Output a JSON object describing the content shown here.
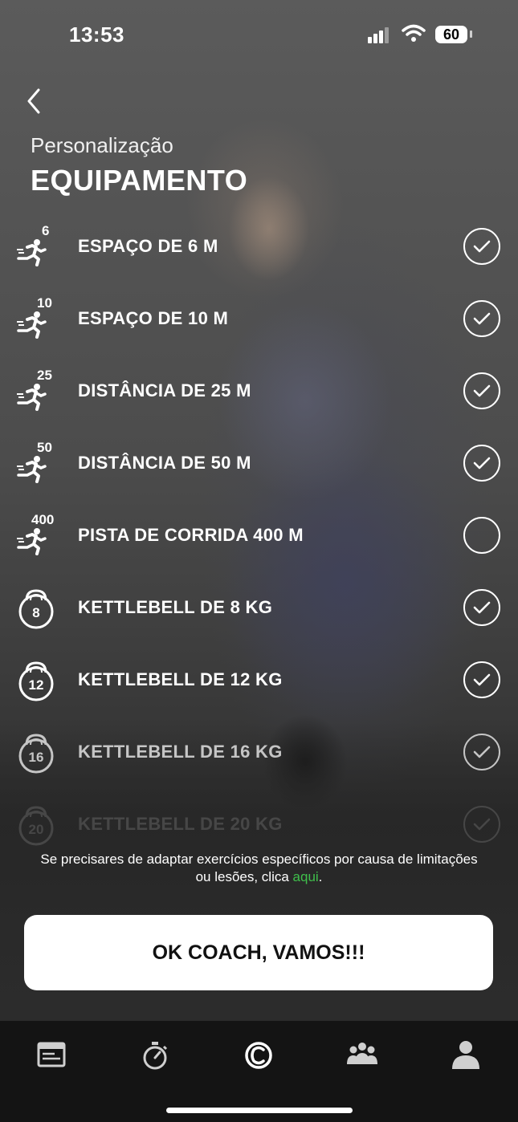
{
  "status_bar": {
    "time": "13:53",
    "battery": "60"
  },
  "header": {
    "subtitle": "Personalização",
    "title": "EQUIPAMENTO"
  },
  "equipment": [
    {
      "icon": "runner-icon",
      "badge": "6",
      "label": "ESPAÇO DE 6 M",
      "checked": true
    },
    {
      "icon": "runner-icon",
      "badge": "10",
      "label": "ESPAÇO DE 10 M",
      "checked": true
    },
    {
      "icon": "runner-icon",
      "badge": "25",
      "label": "DISTÂNCIA DE 25 M",
      "checked": true
    },
    {
      "icon": "runner-icon",
      "badge": "50",
      "label": "DISTÂNCIA DE 50 M",
      "checked": true
    },
    {
      "icon": "runner-icon",
      "badge": "400",
      "label": "PISTA DE CORRIDA 400 M",
      "checked": false
    },
    {
      "icon": "kettlebell-icon",
      "badge": "8",
      "label": "KETTLEBELL DE 8 KG",
      "checked": true
    },
    {
      "icon": "kettlebell-icon",
      "badge": "12",
      "label": "KETTLEBELL DE 12 KG",
      "checked": true
    },
    {
      "icon": "kettlebell-icon",
      "badge": "16",
      "label": "KETTLEBELL DE 16 KG",
      "checked": true
    },
    {
      "icon": "kettlebell-icon",
      "badge": "20",
      "label": "KETTLEBELL DE 20 KG",
      "checked": true
    }
  ],
  "notice": {
    "text": "Se precisares de adaptar exercícios específicos por causa de limitações ou lesões, clica ",
    "link": "aqui",
    "end": "."
  },
  "cta": {
    "label": "OK COACH, VAMOS!!!"
  },
  "tabs": [
    {
      "icon": "news-icon"
    },
    {
      "icon": "stopwatch-icon"
    },
    {
      "icon": "coach-logo-icon"
    },
    {
      "icon": "community-icon"
    },
    {
      "icon": "profile-icon"
    }
  ],
  "colors": {
    "link": "#3fbf4b",
    "tab_bar": "#141414",
    "button": "#ffffff"
  }
}
